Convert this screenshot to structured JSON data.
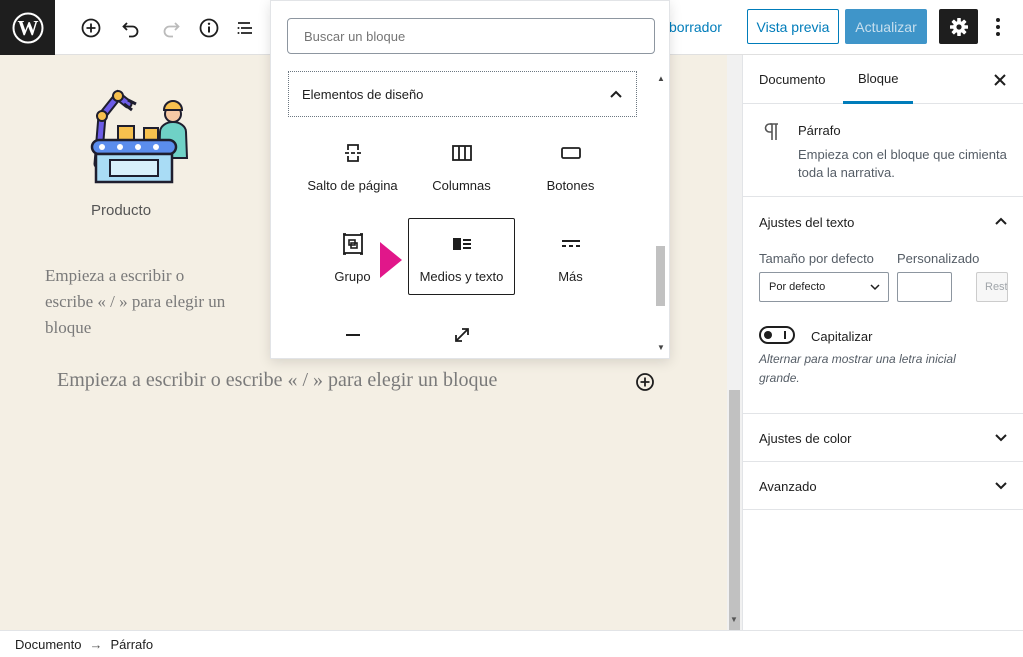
{
  "toolbar": {
    "draft_link": "borrador",
    "preview_label": "Vista previa",
    "update_label": "Actualizar"
  },
  "inserter": {
    "search_placeholder": "Buscar un bloque",
    "panel_title": "Elementos de diseño",
    "blocks": [
      {
        "label": "Salto de página",
        "icon": "page-break-icon"
      },
      {
        "label": "Columnas",
        "icon": "columns-icon"
      },
      {
        "label": "Botones",
        "icon": "buttons-icon"
      },
      {
        "label": "Grupo",
        "icon": "group-icon"
      },
      {
        "label": "Medios y texto",
        "icon": "media-text-icon",
        "selected": true
      },
      {
        "label": "Más",
        "icon": "more-icon"
      },
      {
        "label": "",
        "icon": "separator-icon"
      },
      {
        "label": "",
        "icon": "spacer-icon"
      }
    ]
  },
  "editor": {
    "product_label": "Producto",
    "placeholder_small": "Empieza a escribir o escribe « / » para elegir un bloque",
    "placeholder_wide": "Empieza a escribir o escribe « / » para elegir un bloque"
  },
  "sidebar": {
    "tabs": [
      {
        "label": "Documento",
        "active": false
      },
      {
        "label": "Bloque",
        "active": true
      }
    ],
    "block_card": {
      "title": "Párrafo",
      "description": "Empieza con el bloque que cimienta toda la narrativa."
    },
    "text_settings": {
      "title": "Ajustes del texto",
      "size_label": "Tamaño por defecto",
      "custom_label": "Personalizado",
      "size_value": "Por defecto",
      "reset_label": "Restablecer",
      "toggle_label": "Capitalizar",
      "toggle_help": "Alternar para mostrar una letra inicial grande."
    },
    "color_settings": {
      "title": "Ajustes de color"
    },
    "advanced": {
      "title": "Avanzado"
    }
  },
  "footer": {
    "crumbs": [
      "Documento",
      "Párrafo"
    ],
    "separator": "→"
  },
  "colors": {
    "accent": "#007cba",
    "update_button": "#3f95c9",
    "canvas_bg": "#f4efe4",
    "pointer": "#e1178a"
  }
}
